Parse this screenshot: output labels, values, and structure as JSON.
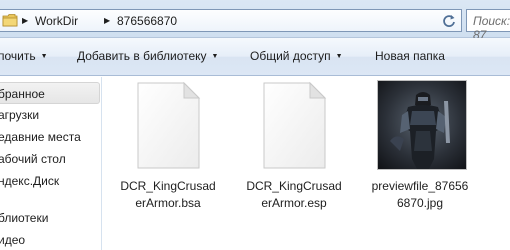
{
  "address_bar": {
    "crumbs": [
      "WorkDir",
      "876566870"
    ],
    "search_placeholder": "Поиск: 87"
  },
  "command_bar": {
    "organize": "почить",
    "add_to_library": "Добавить в библиотеку",
    "share": "Общий доступ",
    "new_folder": "Новая папка"
  },
  "nav": {
    "items": [
      {
        "label": "бранное",
        "selected": true
      },
      {
        "label": "агрузки"
      },
      {
        "label": "едавние места"
      },
      {
        "label": "абочий стол"
      },
      {
        "label": "ндекс.Диск"
      },
      {
        "label": "блиотеки"
      },
      {
        "label": "идео"
      }
    ]
  },
  "files": [
    {
      "name_line1": "DCR_KingCrusad",
      "name_line2": "erArmor.bsa",
      "icon": "blank-file-icon"
    },
    {
      "name_line1": "DCR_KingCrusad",
      "name_line2": "erArmor.esp",
      "icon": "blank-file-icon"
    },
    {
      "name_line1": "previewfile_87656",
      "name_line2": "6870.jpg",
      "icon": "image-thumbnail"
    }
  ]
}
